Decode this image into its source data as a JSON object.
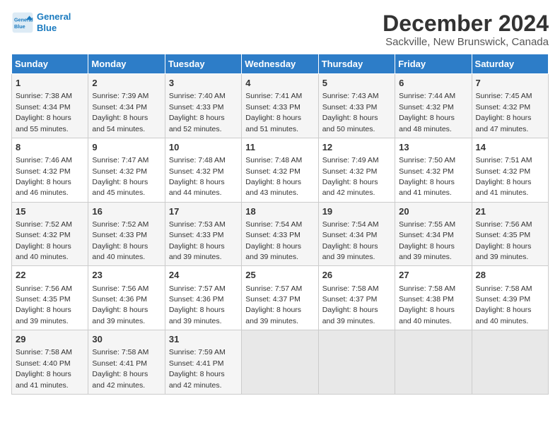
{
  "logo": {
    "line1": "General",
    "line2": "Blue"
  },
  "title": "December 2024",
  "subtitle": "Sackville, New Brunswick, Canada",
  "days_header": [
    "Sunday",
    "Monday",
    "Tuesday",
    "Wednesday",
    "Thursday",
    "Friday",
    "Saturday"
  ],
  "weeks": [
    [
      {
        "day": 1,
        "rise": "7:38 AM",
        "set": "4:34 PM",
        "daylight": "8 hours and 55 minutes."
      },
      {
        "day": 2,
        "rise": "7:39 AM",
        "set": "4:34 PM",
        "daylight": "8 hours and 54 minutes."
      },
      {
        "day": 3,
        "rise": "7:40 AM",
        "set": "4:33 PM",
        "daylight": "8 hours and 52 minutes."
      },
      {
        "day": 4,
        "rise": "7:41 AM",
        "set": "4:33 PM",
        "daylight": "8 hours and 51 minutes."
      },
      {
        "day": 5,
        "rise": "7:43 AM",
        "set": "4:33 PM",
        "daylight": "8 hours and 50 minutes."
      },
      {
        "day": 6,
        "rise": "7:44 AM",
        "set": "4:32 PM",
        "daylight": "8 hours and 48 minutes."
      },
      {
        "day": 7,
        "rise": "7:45 AM",
        "set": "4:32 PM",
        "daylight": "8 hours and 47 minutes."
      }
    ],
    [
      {
        "day": 8,
        "rise": "7:46 AM",
        "set": "4:32 PM",
        "daylight": "8 hours and 46 minutes."
      },
      {
        "day": 9,
        "rise": "7:47 AM",
        "set": "4:32 PM",
        "daylight": "8 hours and 45 minutes."
      },
      {
        "day": 10,
        "rise": "7:48 AM",
        "set": "4:32 PM",
        "daylight": "8 hours and 44 minutes."
      },
      {
        "day": 11,
        "rise": "7:48 AM",
        "set": "4:32 PM",
        "daylight": "8 hours and 43 minutes."
      },
      {
        "day": 12,
        "rise": "7:49 AM",
        "set": "4:32 PM",
        "daylight": "8 hours and 42 minutes."
      },
      {
        "day": 13,
        "rise": "7:50 AM",
        "set": "4:32 PM",
        "daylight": "8 hours and 41 minutes."
      },
      {
        "day": 14,
        "rise": "7:51 AM",
        "set": "4:32 PM",
        "daylight": "8 hours and 41 minutes."
      }
    ],
    [
      {
        "day": 15,
        "rise": "7:52 AM",
        "set": "4:32 PM",
        "daylight": "8 hours and 40 minutes."
      },
      {
        "day": 16,
        "rise": "7:52 AM",
        "set": "4:33 PM",
        "daylight": "8 hours and 40 minutes."
      },
      {
        "day": 17,
        "rise": "7:53 AM",
        "set": "4:33 PM",
        "daylight": "8 hours and 39 minutes."
      },
      {
        "day": 18,
        "rise": "7:54 AM",
        "set": "4:33 PM",
        "daylight": "8 hours and 39 minutes."
      },
      {
        "day": 19,
        "rise": "7:54 AM",
        "set": "4:34 PM",
        "daylight": "8 hours and 39 minutes."
      },
      {
        "day": 20,
        "rise": "7:55 AM",
        "set": "4:34 PM",
        "daylight": "8 hours and 39 minutes."
      },
      {
        "day": 21,
        "rise": "7:56 AM",
        "set": "4:35 PM",
        "daylight": "8 hours and 39 minutes."
      }
    ],
    [
      {
        "day": 22,
        "rise": "7:56 AM",
        "set": "4:35 PM",
        "daylight": "8 hours and 39 minutes."
      },
      {
        "day": 23,
        "rise": "7:56 AM",
        "set": "4:36 PM",
        "daylight": "8 hours and 39 minutes."
      },
      {
        "day": 24,
        "rise": "7:57 AM",
        "set": "4:36 PM",
        "daylight": "8 hours and 39 minutes."
      },
      {
        "day": 25,
        "rise": "7:57 AM",
        "set": "4:37 PM",
        "daylight": "8 hours and 39 minutes."
      },
      {
        "day": 26,
        "rise": "7:58 AM",
        "set": "4:37 PM",
        "daylight": "8 hours and 39 minutes."
      },
      {
        "day": 27,
        "rise": "7:58 AM",
        "set": "4:38 PM",
        "daylight": "8 hours and 40 minutes."
      },
      {
        "day": 28,
        "rise": "7:58 AM",
        "set": "4:39 PM",
        "daylight": "8 hours and 40 minutes."
      }
    ],
    [
      {
        "day": 29,
        "rise": "7:58 AM",
        "set": "4:40 PM",
        "daylight": "8 hours and 41 minutes."
      },
      {
        "day": 30,
        "rise": "7:58 AM",
        "set": "4:41 PM",
        "daylight": "8 hours and 42 minutes."
      },
      {
        "day": 31,
        "rise": "7:59 AM",
        "set": "4:41 PM",
        "daylight": "8 hours and 42 minutes."
      },
      null,
      null,
      null,
      null
    ]
  ],
  "labels": {
    "sunrise": "Sunrise:",
    "sunset": "Sunset:",
    "daylight": "Daylight:"
  }
}
